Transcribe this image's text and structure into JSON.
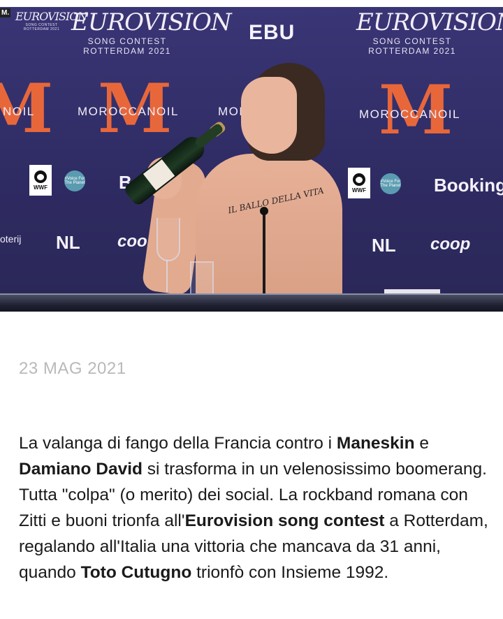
{
  "hero": {
    "eurovision_title": "EUROVISION",
    "song_contest": "SONG CONTEST",
    "city_year": "ROTTERDAM 2021",
    "ebu": "EBU",
    "moroccanoil": "MOROCCANOIL",
    "moroccanoil_partial_left": "NOIL",
    "moroccanoil_partial_mid": "MOR",
    "booking": "Booking.",
    "booking_partial": "Boo",
    "nl": "NL",
    "coop": "coop",
    "loterij_partial": "oterij",
    "wwf": "WWF",
    "voice_planet": "#Voice For The Planet",
    "tattoo_text": "IL BALLO DELLA VITA",
    "small_corner_label": "M."
  },
  "article": {
    "date": "23 MAG 2021",
    "paragraph": [
      {
        "text": "La valanga di fango della Francia contro i ",
        "bold": false
      },
      {
        "text": "Maneskin",
        "bold": true
      },
      {
        "text": " e ",
        "bold": false
      },
      {
        "text": "Damiano David",
        "bold": true
      },
      {
        "text": " si trasforma in un velenosissimo boomerang. Tutta \"colpa\" (o merito) dei social. La rockband romana con Zitti e buoni trionfa all'",
        "bold": false
      },
      {
        "text": "Eurovision song contest",
        "bold": true
      },
      {
        "text": " a Rotterdam, regalando all'Italia una vittoria che mancava da 31 anni, quando ",
        "bold": false
      },
      {
        "text": "Toto Cutugno",
        "bold": true
      },
      {
        "text": " trionfò con Insieme 1992.",
        "bold": false
      }
    ]
  },
  "colors": {
    "backdrop": "#34306c",
    "moroccanoil_accent": "#e8673a",
    "date_text": "#b9b9b9",
    "body_text": "#1a1a1a"
  }
}
